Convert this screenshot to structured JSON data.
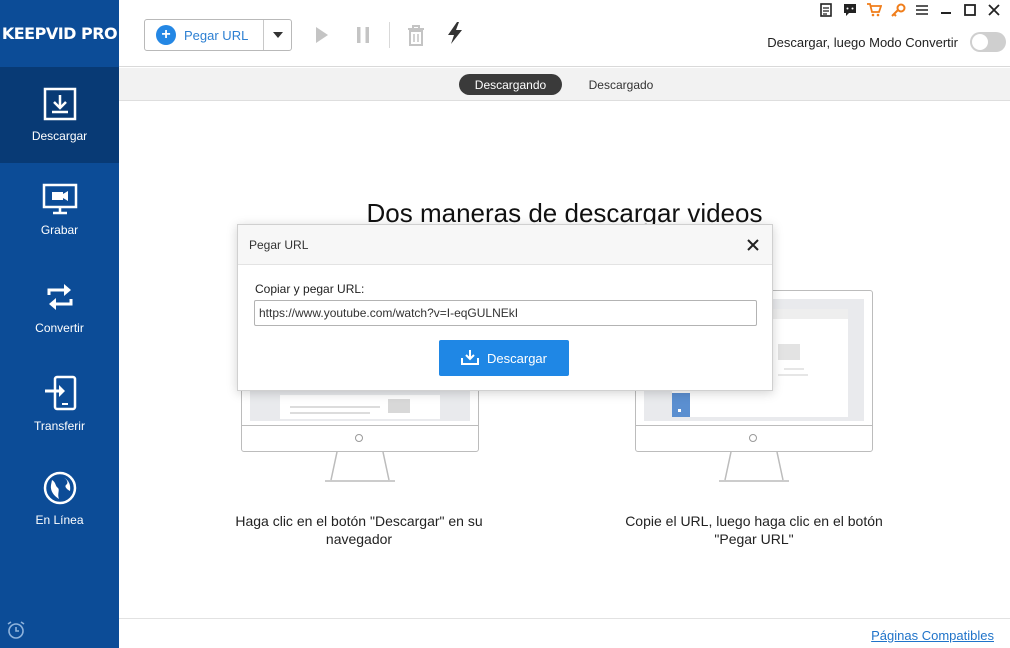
{
  "app": {
    "logo": "KEEPVID PRO"
  },
  "sidebar": {
    "items": [
      {
        "label": "Descargar",
        "icon": "download-icon",
        "active": true
      },
      {
        "label": "Grabar",
        "icon": "record-screen-icon",
        "active": false
      },
      {
        "label": "Convertir",
        "icon": "convert-icon",
        "active": false
      },
      {
        "label": "Transferir",
        "icon": "transfer-icon",
        "active": false
      },
      {
        "label": "En Línea",
        "icon": "globe-icon",
        "active": false
      }
    ],
    "bottom_icon": "alarm-clock-icon"
  },
  "toolbar": {
    "paste_label": "Pegar URL",
    "convert_mode_label": "Descargar, luego Modo Convertir",
    "convert_mode_enabled": false,
    "icons": [
      "play-icon",
      "pause-icon",
      "trash-icon",
      "lightning-icon"
    ],
    "window_icons": [
      "notepad-icon",
      "chat-icon",
      "cart-icon",
      "key-icon",
      "menu-icon",
      "minimize-icon",
      "maximize-icon",
      "close-icon"
    ]
  },
  "tabs": [
    {
      "label": "Descargando",
      "active": true
    },
    {
      "label": "Descargado",
      "active": false
    }
  ],
  "main": {
    "headline": "Dos maneras de descargar videos",
    "caption_left": "Haga clic en el botón \"Descargar\" en su navegador",
    "caption_right": "Copie el URL, luego haga clic en el botón \"Pegar URL\"",
    "footer_link": "Páginas Compatibles"
  },
  "dialog": {
    "title": "Pegar URL",
    "label": "Copiar y pegar URL:",
    "url_value": "https://www.youtube.com/watch?v=I-eqGULNEkI",
    "button_label": "Descargar"
  },
  "colors": {
    "sidebar": "#0c4c97",
    "sidebar_active": "#083a75",
    "accent": "#1f87e5",
    "link": "#1f73c9"
  }
}
